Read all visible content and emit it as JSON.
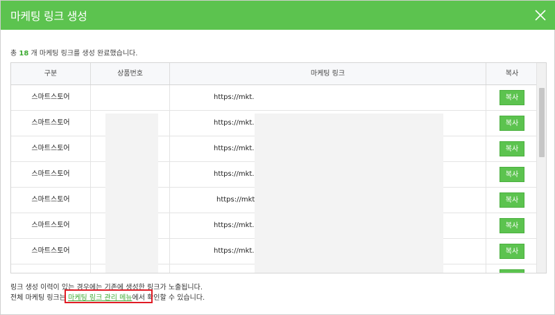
{
  "header": {
    "title": "마케팅 링크 생성"
  },
  "summary": {
    "prefix": "총",
    "count": "18",
    "suffix": "개 마케팅 링크를 생성 완료했습니다."
  },
  "table": {
    "columns": [
      "구분",
      "상품번호",
      "마케팅 링크",
      "복사"
    ],
    "rows": [
      {
        "category": "스마트스토어",
        "link": "https://mkt.",
        "copy_label": "복사"
      },
      {
        "category": "스마트스토어",
        "link": "https://mkt.",
        "copy_label": "복사"
      },
      {
        "category": "스마트스토어",
        "link": "https://mkt.",
        "copy_label": "복사"
      },
      {
        "category": "스마트스토어",
        "link": "https://mkt.",
        "copy_label": "복사"
      },
      {
        "category": "스마트스토어",
        "link": "https://mkt",
        "copy_label": "복사"
      },
      {
        "category": "스마트스토어",
        "link": "https://mkt.",
        "copy_label": "복사"
      },
      {
        "category": "스마트스토어",
        "link": "https://mkt.",
        "copy_label": "복사"
      },
      {
        "category": "",
        "link": "",
        "copy_label": "복사"
      }
    ]
  },
  "notes": {
    "line1": "링크 생성 이력이 있는 경우에는 기존에 생성한 링크가 노출됩니다.",
    "line2_prefix": "전체 마케팅 링크는",
    "line2_link": "마케팅 링크 관리 메뉴",
    "line2_suffix": "에서 확인할 수 있습니다."
  },
  "colors": {
    "accent": "#5cc34f",
    "highlight": "#e01b24"
  },
  "icons": {
    "close": "close-icon"
  }
}
